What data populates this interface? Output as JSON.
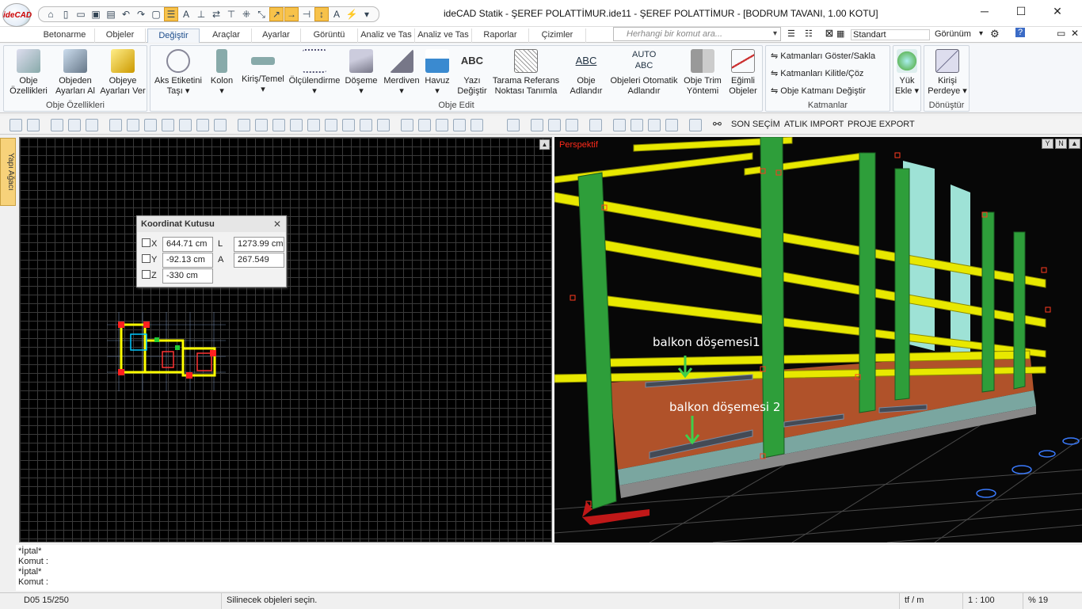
{
  "app": {
    "logo_text": "ideCAD",
    "window_title": "ideCAD Statik - ŞEREF POLATTİMUR.ide11 - ŞEREF POLATTİMUR - [BODRUM TAVANI,  1.00 KOTU]",
    "controls": {
      "minimize": "─",
      "maximize": "☐",
      "close": "✕"
    }
  },
  "tabs": [
    "Betonarme",
    "Objeler",
    "Değiştir",
    "Araçlar",
    "Ayarlar",
    "Görüntü",
    "Analiz ve Tas",
    "Analiz ve Tas",
    "Raporlar",
    "Çizimler"
  ],
  "active_tab": "Değiştir",
  "command_search": {
    "placeholder": "Herhangi bir komut ara..."
  },
  "right_toolbar": {
    "style_value": "Standart",
    "view_label": "Görünüm"
  },
  "ribbon": {
    "obje_ozellikleri": {
      "label": "Obje Özellikleri",
      "buttons": [
        "Obje\nÖzellikleri",
        "Objeden\nAyarları Al",
        "Objeye\nAyarları Ver"
      ]
    },
    "obje_edit": {
      "label": "Obje Edit",
      "buttons": [
        "Aks Etiketini\nTaşı ▾",
        "Kolon\n▾",
        "Kiriş/Temel\n▾",
        "Ölçülendirme\n▾",
        "Döşeme\n▾",
        "Merdiven\n▾",
        "Havuz\n▾",
        "Yazı\nDeğiştir",
        "Tarama Referans\nNoktası Tanımla",
        "Obje\nAdlandır",
        "Objeleri Otomatik\nAdlandır",
        "Obje Trim\nYöntemi",
        "Eğimli\nObjeler"
      ]
    },
    "katmanlar": {
      "label": "Katmanlar",
      "items": [
        "Katmanları Göster/Sakla",
        "Katmanları Kilitle/Çöz",
        "Obje Katmanı Değiştir"
      ]
    },
    "yuk_ekle": "Yük\nEkle ▾",
    "donustur": {
      "label": "Dönüştür",
      "button": "Kirişi\nPerdeye ▾"
    }
  },
  "secondary_toolbar": {
    "labels": [
      "SON SEÇİM",
      "ATLIK IMPORT",
      "PROJE EXPORT"
    ]
  },
  "side_panel": {
    "label": "Yapı Ağacı"
  },
  "coordinate_box": {
    "title": "Koordinat Kutusu",
    "x_label": "X",
    "x_value": "644.71 cm",
    "y_label": "Y",
    "y_value": "-92.13 cm",
    "z_label": "Z",
    "z_value": "-330 cm",
    "l_label": "L",
    "l_value": "1273.99 cm",
    "a_label": "A",
    "a_value": "267.549"
  },
  "viewport3d": {
    "perspective_label": "Perspektif",
    "annotations": [
      "balkon döşemesi1",
      "balkon döşemesi 2"
    ],
    "corner_buttons": [
      "Y",
      "N",
      "▲"
    ]
  },
  "command_lines": [
    "*İptal*",
    "Komut :",
    "*İptal*",
    "Komut :"
  ],
  "status_bar": {
    "layer": "D05 15/250",
    "prompt": "Silinecek objeleri seçin.",
    "unit": "tf / m",
    "scale": "1 : 100",
    "zoom": "% 19"
  },
  "colors": {
    "accent": "#1e4e8c",
    "beam": "#e8e800",
    "column": "#2e9e3a",
    "wall": "#b0522a",
    "core": "#9ee2d6",
    "marker": "#ff3b1f"
  }
}
